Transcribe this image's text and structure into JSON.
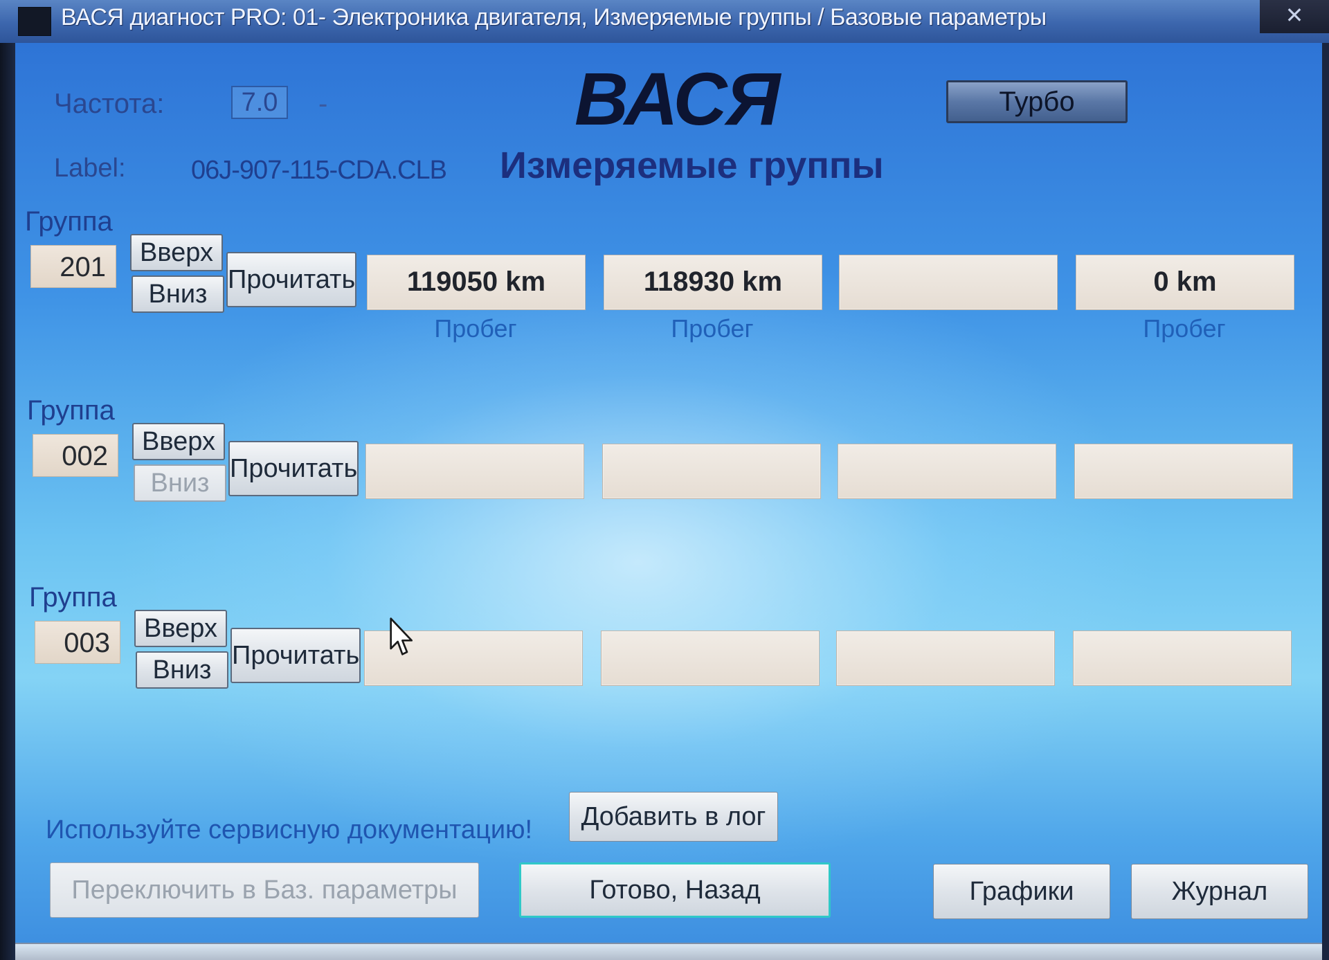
{
  "window": {
    "title": "ВАСЯ диагност PRO: 01- Электроника двигателя,  Измеряемые группы / Базовые параметры",
    "close_label": "✕"
  },
  "header": {
    "freq_label": "Частота:",
    "freq_value": "7.0",
    "freq_suffix": "-",
    "logo": "ВАСЯ",
    "turbo_label": "Турбо",
    "label_label": "Label:",
    "label_value": "06J-907-115-CDA.CLB",
    "section_title": "Измеряемые группы"
  },
  "groups": [
    {
      "title": "Группа",
      "number": "201",
      "up_label": "Вверх",
      "down_label": "Вниз",
      "down_disabled": false,
      "read_label": "Прочитать",
      "fields": [
        {
          "value": "119050 km",
          "unit": "Пробег"
        },
        {
          "value": "118930 km",
          "unit": "Пробег"
        },
        {
          "value": "",
          "unit": ""
        },
        {
          "value": "0 km",
          "unit": "Пробег"
        }
      ]
    },
    {
      "title": "Группа",
      "number": "002",
      "up_label": "Вверх",
      "down_label": "Вниз",
      "down_disabled": true,
      "read_label": "Прочитать",
      "fields": [
        {
          "value": "",
          "unit": ""
        },
        {
          "value": "",
          "unit": ""
        },
        {
          "value": "",
          "unit": ""
        },
        {
          "value": "",
          "unit": ""
        }
      ]
    },
    {
      "title": "Группа",
      "number": "003",
      "up_label": "Вверх",
      "down_label": "Вниз",
      "down_disabled": false,
      "read_label": "Прочитать",
      "fields": [
        {
          "value": "",
          "unit": ""
        },
        {
          "value": "",
          "unit": ""
        },
        {
          "value": "",
          "unit": ""
        },
        {
          "value": "",
          "unit": ""
        }
      ]
    }
  ],
  "footer": {
    "hint": "Используйте сервисную документацию!",
    "add_log_label": "Добавить в лог",
    "switch_label": "Переключить в Баз. параметры",
    "done_label": "Готово, Назад",
    "graphs_label": "Графики",
    "journal_label": "Журнал"
  },
  "colors": {
    "text_blue": "#1f3f8f",
    "unit_blue": "#2060b8",
    "done_border": "#30c8c8"
  }
}
